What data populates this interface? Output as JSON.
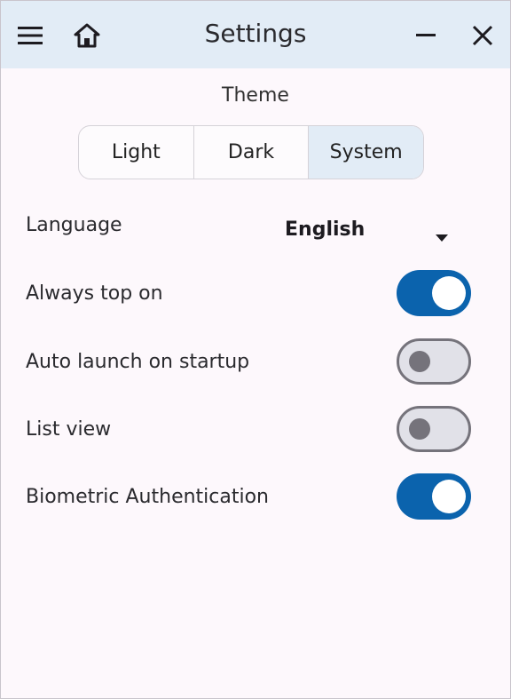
{
  "window": {
    "title": "Settings"
  },
  "titlebar": {
    "menu_icon": "hamburger-menu-icon",
    "home_icon": "home-icon",
    "minimize_icon": "minimize-icon",
    "close_icon": "close-icon"
  },
  "theme": {
    "label": "Theme",
    "options": [
      "Light",
      "Dark",
      "System"
    ],
    "selected": "System"
  },
  "language": {
    "label": "Language",
    "value": "English"
  },
  "toggles": [
    {
      "label": "Always top on",
      "on": true
    },
    {
      "label": "Auto launch on startup",
      "on": false
    },
    {
      "label": "List view",
      "on": false
    },
    {
      "label": "Biometric Authentication",
      "on": true
    }
  ],
  "colors": {
    "titlebar_bg": "#e2ecf6",
    "toggle_on": "#0b63ad",
    "toggle_off_track": "#e1e1e8",
    "toggle_off_border": "#75737b",
    "segment_selected": "#e2ecf6"
  }
}
